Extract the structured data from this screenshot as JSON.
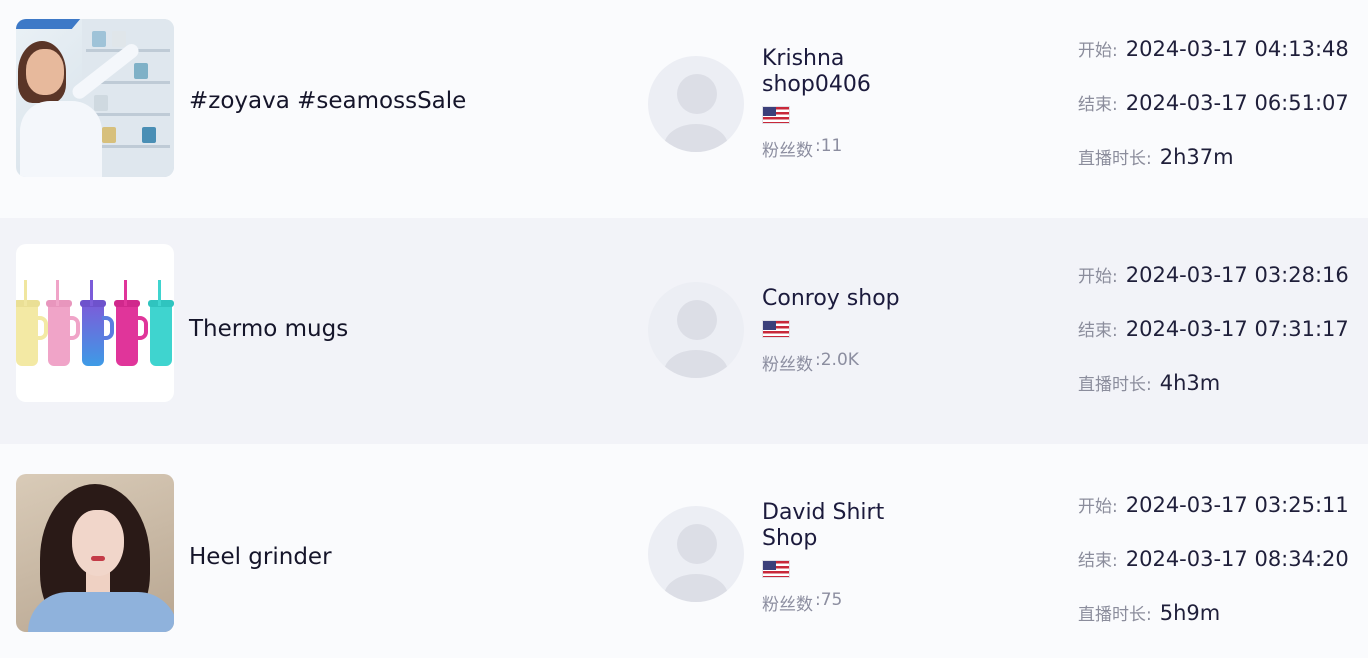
{
  "streams": [
    {
      "title": "#zoyava #seamossSale",
      "shop_name": "Krishna shop0406",
      "fans_label": "粉丝数",
      "fans_value": ":11",
      "start_label": "开始:",
      "start_value": "2024-03-17 04:13:48",
      "end_label": "结束:",
      "end_value": "2024-03-17 06:51:07",
      "duration_label": "直播时长:",
      "duration_value": "2h37m"
    },
    {
      "title": "Thermo mugs",
      "shop_name": "Conroy shop",
      "fans_label": "粉丝数",
      "fans_value": ":2.0K",
      "start_label": "开始:",
      "start_value": "2024-03-17 03:28:16",
      "end_label": "结束:",
      "end_value": "2024-03-17 07:31:17",
      "duration_label": "直播时长:",
      "duration_value": "4h3m"
    },
    {
      "title": "Heel grinder",
      "shop_name": "David Shirt Shop",
      "fans_label": "粉丝数",
      "fans_value": ":75",
      "start_label": "开始:",
      "start_value": "2024-03-17 03:25:11",
      "end_label": "结束:",
      "end_value": "2024-03-17 08:34:20",
      "duration_label": "直播时长:",
      "duration_value": "5h9m"
    }
  ],
  "icons": {
    "flag": "us-flag-icon",
    "avatar": "default-avatar-icon"
  }
}
